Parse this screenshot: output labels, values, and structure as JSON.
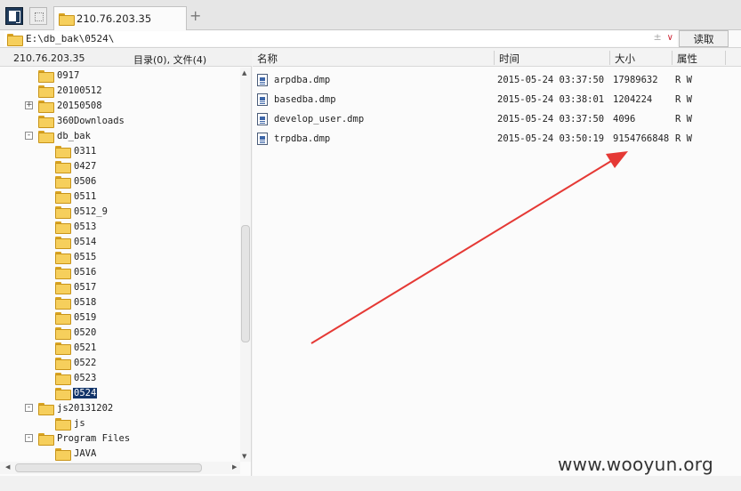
{
  "tab": {
    "title": "210.76.203.35",
    "add_label": "+"
  },
  "address": {
    "path": "E:\\db_bak\\0524\\",
    "controls": "±",
    "read_label": "读取"
  },
  "left_header": {
    "host": "210.76.203.35",
    "count": "目录(0), 文件(4)"
  },
  "tree": [
    {
      "label": "0917",
      "depth": 1,
      "toggle": ""
    },
    {
      "label": "20100512",
      "depth": 1,
      "toggle": ""
    },
    {
      "label": "20150508",
      "depth": 1,
      "toggle": "+"
    },
    {
      "label": "360Downloads",
      "depth": 1,
      "toggle": ""
    },
    {
      "label": "db_bak",
      "depth": 1,
      "toggle": "-"
    },
    {
      "label": "0311",
      "depth": 2,
      "toggle": ""
    },
    {
      "label": "0427",
      "depth": 2,
      "toggle": ""
    },
    {
      "label": "0506",
      "depth": 2,
      "toggle": ""
    },
    {
      "label": "0511",
      "depth": 2,
      "toggle": ""
    },
    {
      "label": "0512_9",
      "depth": 2,
      "toggle": ""
    },
    {
      "label": "0513",
      "depth": 2,
      "toggle": ""
    },
    {
      "label": "0514",
      "depth": 2,
      "toggle": ""
    },
    {
      "label": "0515",
      "depth": 2,
      "toggle": ""
    },
    {
      "label": "0516",
      "depth": 2,
      "toggle": ""
    },
    {
      "label": "0517",
      "depth": 2,
      "toggle": ""
    },
    {
      "label": "0518",
      "depth": 2,
      "toggle": ""
    },
    {
      "label": "0519",
      "depth": 2,
      "toggle": ""
    },
    {
      "label": "0520",
      "depth": 2,
      "toggle": ""
    },
    {
      "label": "0521",
      "depth": 2,
      "toggle": ""
    },
    {
      "label": "0522",
      "depth": 2,
      "toggle": ""
    },
    {
      "label": "0523",
      "depth": 2,
      "toggle": ""
    },
    {
      "label": "0524",
      "depth": 2,
      "toggle": "",
      "selected": true
    },
    {
      "label": "js20131202",
      "depth": 1,
      "toggle": "-"
    },
    {
      "label": "js",
      "depth": 2,
      "toggle": ""
    },
    {
      "label": "Program Files",
      "depth": 1,
      "toggle": "-"
    },
    {
      "label": "JAVA",
      "depth": 2,
      "toggle": ""
    }
  ],
  "columns": {
    "name": "名称",
    "time": "时间",
    "size": "大小",
    "attr": "属性"
  },
  "files": [
    {
      "name": "arpdba.dmp",
      "time": "2015-05-24 03:37:50",
      "size": "17989632",
      "attr": "R W"
    },
    {
      "name": "basedba.dmp",
      "time": "2015-05-24 03:38:01",
      "size": "1204224",
      "attr": "R W"
    },
    {
      "name": "develop_user.dmp",
      "time": "2015-05-24 03:37:50",
      "size": "4096",
      "attr": "R W"
    },
    {
      "name": "trpdba.dmp",
      "time": "2015-05-24 03:50:19",
      "size": "9154766848",
      "attr": "R W"
    }
  ],
  "watermark": "www.wooyun.org",
  "colors": {
    "selection": "#13356a",
    "arrow": "#e53935",
    "folder": "#f6cf5c"
  }
}
